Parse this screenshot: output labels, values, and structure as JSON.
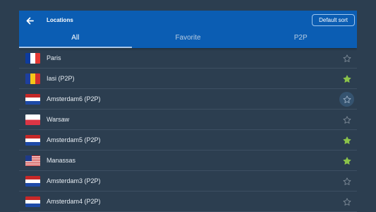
{
  "header": {
    "title": "Locations",
    "back_icon": "arrow-left-icon",
    "sort_label": "Default sort"
  },
  "tabs": [
    {
      "label": "All",
      "active": true
    },
    {
      "label": "Favorite",
      "active": false
    },
    {
      "label": "P2P",
      "active": false
    }
  ],
  "locations": [
    {
      "name": "Paris",
      "flag": "france",
      "favorite": false
    },
    {
      "name": "Iasi (P2P)",
      "flag": "romania",
      "favorite": true
    },
    {
      "name": "Amsterdam6 (P2P)",
      "flag": "netherlands",
      "favorite": false,
      "focused": true
    },
    {
      "name": "Warsaw",
      "flag": "poland",
      "favorite": false
    },
    {
      "name": "Amsterdam5 (P2P)",
      "flag": "netherlands",
      "favorite": true
    },
    {
      "name": "Manassas",
      "flag": "usa",
      "favorite": true
    },
    {
      "name": "Amsterdam3 (P2P)",
      "flag": "netherlands",
      "favorite": false
    },
    {
      "name": "Amsterdam4 (P2P)",
      "flag": "netherlands",
      "favorite": false
    }
  ],
  "colors": {
    "background": "#2c3e50",
    "header": "#0b5db3",
    "favorite_star": "#8bc34a",
    "empty_star": "#7f8c99"
  }
}
